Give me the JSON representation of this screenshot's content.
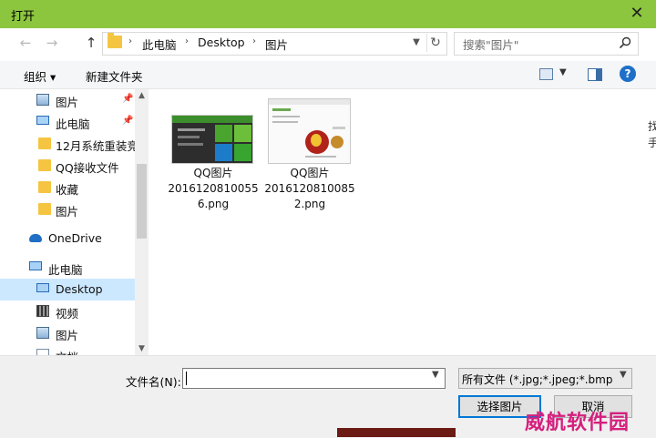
{
  "window": {
    "title": "打开",
    "close_symbol": "✕"
  },
  "nav_buttons": {
    "back": "←",
    "forward": "→",
    "up": "↑"
  },
  "breadcrumb": {
    "items": [
      "此电脑",
      "Desktop",
      "图片"
    ],
    "separator": "›"
  },
  "search": {
    "placeholder": "搜索\"图片\""
  },
  "toolbar": {
    "organize": "组织 ▾",
    "new_folder": "新建文件夹",
    "view_dd": "▼",
    "help": "?"
  },
  "sidebar": {
    "items": [
      {
        "label": "图片",
        "pinned": true
      },
      {
        "label": "此电脑",
        "pinned": true
      },
      {
        "label": "12月系统重装竞"
      },
      {
        "label": "QQ接收文件"
      },
      {
        "label": "收藏"
      },
      {
        "label": "图片"
      },
      {
        "label": "OneDrive"
      },
      {
        "label": "此电脑"
      },
      {
        "label": "Desktop",
        "selected": true
      },
      {
        "label": "视频"
      },
      {
        "label": "图片"
      },
      {
        "label": "文档"
      }
    ],
    "pin_symbol": "📌"
  },
  "files": [
    {
      "name_line1": "QQ图片",
      "name_line2": "2016120810055",
      "name_line3": "6.png"
    },
    {
      "name_line1": "QQ图片",
      "name_line2": "2016120810085",
      "name_line3": "2.png"
    }
  ],
  "footer": {
    "filename_label": "文件名(N):",
    "filename_value": "",
    "filetype_value": "所有文件 (*.jpg;*.jpeg;*.bmp;*.",
    "open_label": "选择图片",
    "cancel_label": "取消"
  },
  "overlay": {
    "right_edge_text": "找\n手",
    "watermark": "威航软件园"
  },
  "colors": {
    "titlebar": "#8cc63f",
    "selection": "#cce8ff",
    "accent": "#0078d7"
  }
}
